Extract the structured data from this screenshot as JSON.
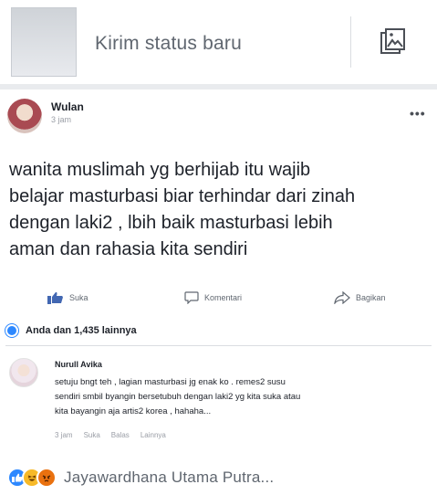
{
  "composer": {
    "placeholder": "Kirim status baru",
    "photo_icon": "photo-gallery-icon"
  },
  "post": {
    "author": "Wulan",
    "time": "3 jam",
    "more_icon": "more-options-icon",
    "more_label": "•••",
    "body_lines": [
      "wanita muslimah yg berhijab itu wajib",
      "belajar masturbasi biar terhindar dari zinah",
      "dengan laki2 , lbih baik masturbasi lebih",
      "aman dan rahasia kita sendiri"
    ],
    "actions": {
      "like": "Suka",
      "comment": "Komentari",
      "share": "Bagikan"
    },
    "reaction_summary": "Anda dan 1,435 lainnya",
    "comment": {
      "author": "Nurull Avika",
      "lines": [
        "setuju bngt teh , lagian masturbasi jg enak ko . remes2 susu",
        "sendiri smbil byangin bersetubuh dengan laki2 yg kita suka atau",
        "kita bayangin aja artis2 korea , hahaha..."
      ],
      "time": "3 jam",
      "like": "Suka",
      "reply": "Balas",
      "more": "Lainnya"
    }
  },
  "footer": {
    "reactions": [
      "like",
      "haha",
      "angry"
    ],
    "text": "Jayawardhana Utama Putra..."
  },
  "colors": {
    "brand_blue": "#2d88ff",
    "text": "#1d2129",
    "muted": "#606770"
  }
}
